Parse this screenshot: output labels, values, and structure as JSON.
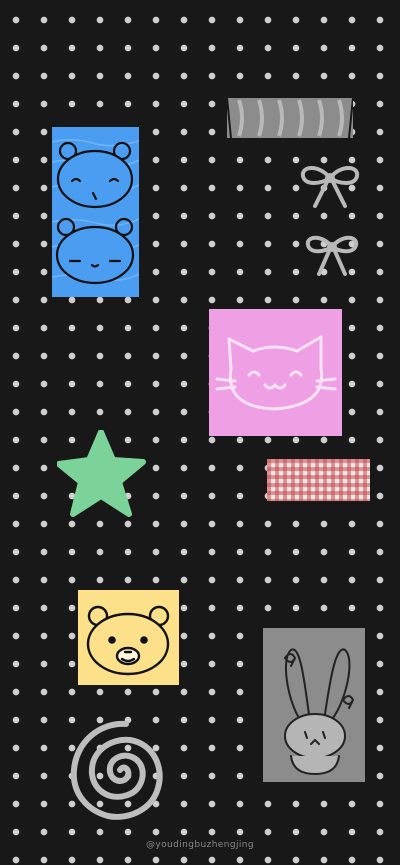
{
  "wallpaper": {
    "background_color": "#181818",
    "dot_color": "#cfcfcf",
    "watermark": "@youdingbuzhengjing"
  },
  "stickers": [
    {
      "name": "blue-bear-stamp",
      "color": "#4a9df0"
    },
    {
      "name": "pink-cat-stamp",
      "color": "#ef9fe4"
    },
    {
      "name": "green-star",
      "color": "#7bd39a"
    },
    {
      "name": "yellow-bear-stamp",
      "color": "#fde08a"
    },
    {
      "name": "gray-bunny-stamp",
      "color": "#8c8c8c"
    },
    {
      "name": "red-gingham-tape",
      "color": "#c84a4a"
    },
    {
      "name": "gray-stripe-tape",
      "color": "#8f8f8f"
    },
    {
      "name": "ribbon-bow",
      "color": "#b9b9b9"
    },
    {
      "name": "spiral",
      "color": "#bdbdbd"
    }
  ]
}
